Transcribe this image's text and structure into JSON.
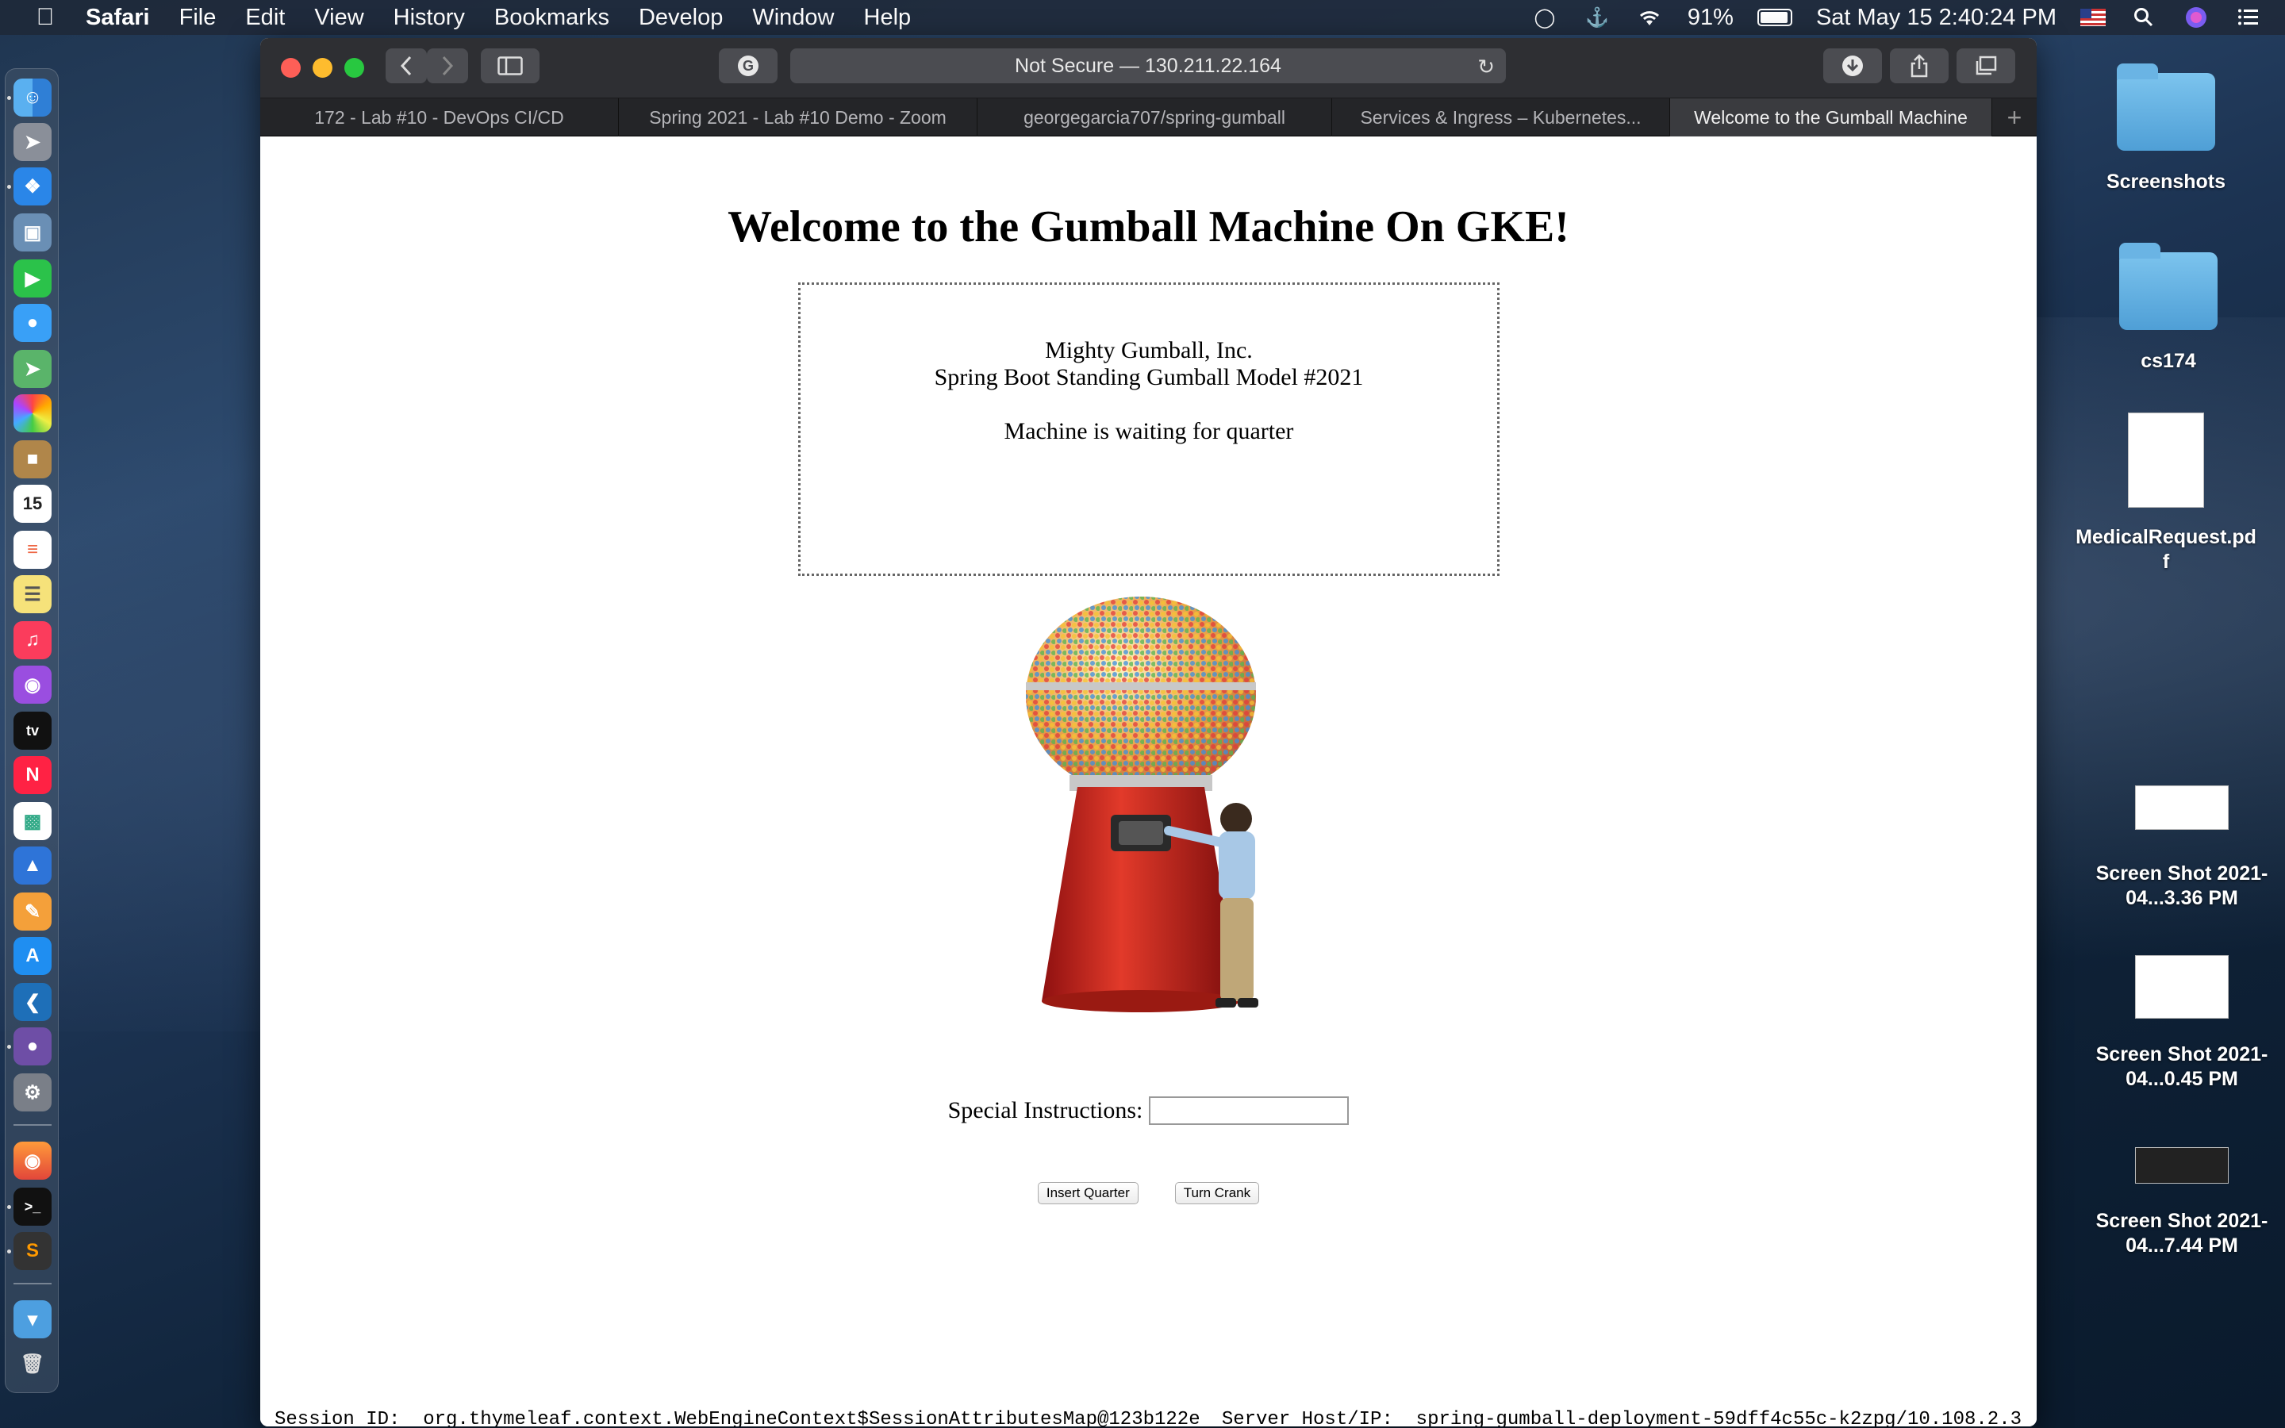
{
  "menubar": {
    "app_name": "Safari",
    "items": [
      "File",
      "Edit",
      "View",
      "History",
      "Bookmarks",
      "Develop",
      "Window",
      "Help"
    ],
    "battery": "91%",
    "datetime": "Sat May 15  2:40:24 PM"
  },
  "browser": {
    "address": "Not Secure — 130.211.22.164",
    "tabs": [
      "172 - Lab #10 - DevOps CI/CD",
      "Spring 2021 - Lab #10 Demo - Zoom",
      "georgegarcia707/spring-gumball",
      "Services & Ingress – Kubernetes...",
      "Welcome to the Gumball Machine"
    ]
  },
  "page": {
    "heading": "Welcome to the Gumball Machine On GKE!",
    "company": "Mighty Gumball, Inc.",
    "model": "Spring Boot Standing Gumball Model #2021",
    "status": "Machine is waiting for quarter",
    "instructions_label": "Special Instructions:",
    "instructions_value": "",
    "insert_quarter": "Insert Quarter",
    "turn_crank": "Turn Crank",
    "session_label": "Session ID:",
    "session_value": "org.thymeleaf.context.WebEngineContext$SessionAttributesMap@123b122e",
    "server_label": "Server Host/IP:",
    "server_value": "spring-gumball-deployment-59dff4c55c-k2zpg/10.108.2.3"
  },
  "desktop": {
    "items": [
      {
        "label": "Screenshots",
        "kind": "folder"
      },
      {
        "label": "cs174",
        "kind": "folder"
      },
      {
        "label": "MedicalRequest.pdf",
        "kind": "document"
      },
      {
        "label": "Screen Shot 2021-04...3.36 PM",
        "kind": "screenshot"
      },
      {
        "label": "Screen Shot 2021-04...0.45 PM",
        "kind": "screenshot"
      },
      {
        "label": "Screen Shot 2021-04...7.44 PM",
        "kind": "screenshot"
      }
    ],
    "calendar_day": "15"
  }
}
